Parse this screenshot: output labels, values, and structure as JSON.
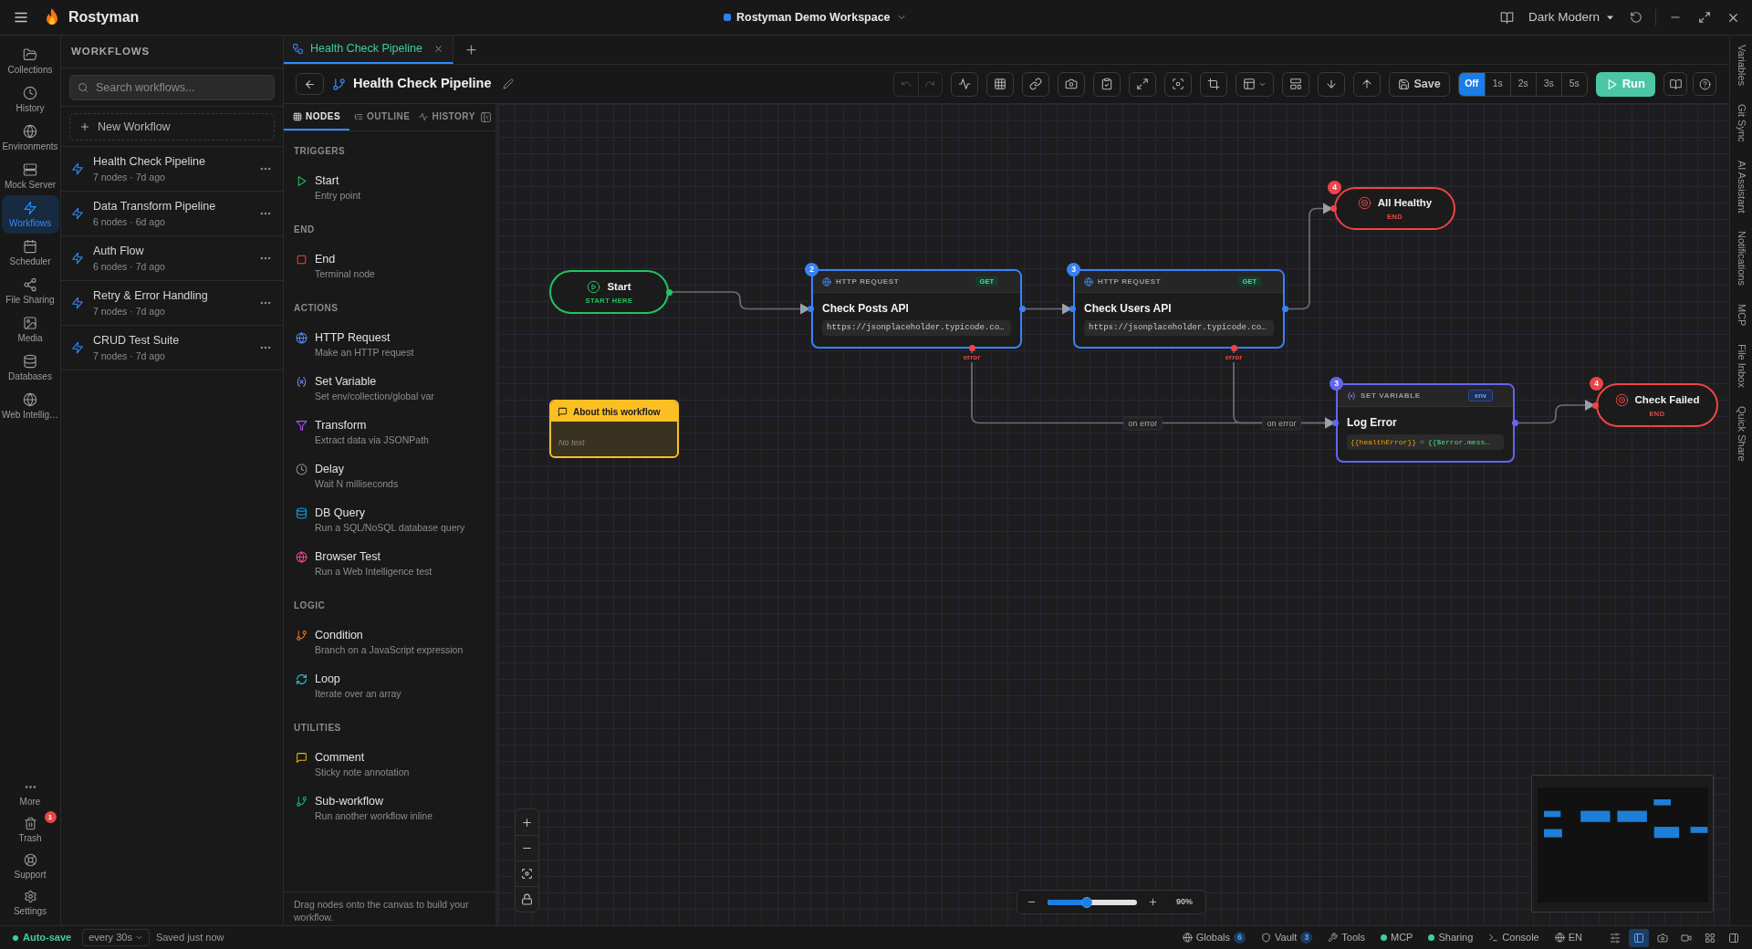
{
  "app_bar": {
    "title": "Rostyman",
    "workspace": "Rostyman Demo Workspace",
    "theme": "Dark Modern"
  },
  "nav_rail": {
    "items": [
      {
        "label": "Collections",
        "selected": false
      },
      {
        "label": "History",
        "selected": false
      },
      {
        "label": "Environments",
        "selected": false
      },
      {
        "label": "Mock Server",
        "selected": false
      },
      {
        "label": "Workflows",
        "selected": true
      },
      {
        "label": "Scheduler",
        "selected": false
      },
      {
        "label": "File Sharing",
        "selected": false
      },
      {
        "label": "Media",
        "selected": false
      },
      {
        "label": "Databases",
        "selected": false
      },
      {
        "label": "Web Intellig…",
        "selected": false
      }
    ],
    "bottom_items": [
      {
        "label": "More"
      },
      {
        "label": "Trash",
        "badge": "1"
      },
      {
        "label": "Support"
      },
      {
        "label": "Settings"
      }
    ]
  },
  "workflows_panel": {
    "title": "WORKFLOWS",
    "search": {
      "placeholder": "Search workflows..."
    },
    "new_button": "New Workflow",
    "items": [
      {
        "name": "Health Check Pipeline",
        "meta": "7 nodes · 7d ago"
      },
      {
        "name": "Data Transform Pipeline",
        "meta": "6 nodes · 6d ago"
      },
      {
        "name": "Auth Flow",
        "meta": "6 nodes · 7d ago"
      },
      {
        "name": "Retry & Error Handling",
        "meta": "7 nodes · 7d ago"
      },
      {
        "name": "CRUD Test Suite",
        "meta": "7 nodes · 7d ago"
      }
    ]
  },
  "tabs": [
    {
      "label": "Health Check Pipeline",
      "selected": true
    }
  ],
  "editor": {
    "title": "Health Check Pipeline",
    "toolbar": {
      "history_buttons": [
        {
          "disabled": true
        },
        {
          "disabled": true
        }
      ],
      "save": "Save",
      "intervals": [
        {
          "label": "Off",
          "selected": true
        },
        {
          "label": "1s",
          "selected": false
        },
        {
          "label": "2s",
          "selected": false
        },
        {
          "label": "3s",
          "selected": false
        },
        {
          "label": "5s",
          "selected": false
        }
      ],
      "run": "Run"
    }
  },
  "palette": {
    "tabs": [
      {
        "label": "NODES",
        "selected": true
      },
      {
        "label": "OUTLINE",
        "selected": false
      },
      {
        "label": "HISTORY",
        "selected": false
      }
    ],
    "sections": [
      {
        "title": "TRIGGERS",
        "items": [
          {
            "kind": "start",
            "name": "Start",
            "description": "Entry point"
          }
        ]
      },
      {
        "title": "END",
        "items": [
          {
            "kind": "end",
            "name": "End",
            "description": "Terminal node"
          }
        ]
      },
      {
        "title": "ACTIONS",
        "items": [
          {
            "kind": "http",
            "name": "HTTP Request",
            "description": "Make an HTTP request"
          },
          {
            "kind": "set_variable",
            "name": "Set Variable",
            "description": "Set env/collection/global var"
          },
          {
            "kind": "transform",
            "name": "Transform",
            "description": "Extract data via JSONPath"
          },
          {
            "kind": "delay",
            "name": "Delay",
            "description": "Wait N milliseconds"
          },
          {
            "kind": "db_query",
            "name": "DB Query",
            "description": "Run a SQL/NoSQL database query"
          },
          {
            "kind": "browser_test",
            "name": "Browser Test",
            "description": "Run a Web Intelligence test"
          }
        ]
      },
      {
        "title": "LOGIC",
        "items": [
          {
            "kind": "condition",
            "name": "Condition",
            "description": "Branch on a JavaScript expression"
          },
          {
            "kind": "loop",
            "name": "Loop",
            "description": "Iterate over an array"
          }
        ]
      },
      {
        "title": "UTILITIES",
        "items": [
          {
            "kind": "comment",
            "name": "Comment",
            "description": "Sticky note annotation"
          },
          {
            "kind": "sub_workflow",
            "name": "Sub-workflow",
            "description": "Run another workflow inline"
          }
        ]
      }
    ],
    "footer": "Drag nodes onto the canvas to build your workflow."
  },
  "canvas": {
    "nodes": [
      {
        "kind": "start",
        "title": "Start",
        "subtitle": "START HERE"
      },
      {
        "kind": "http",
        "step": "2",
        "type_label": "HTTP REQUEST",
        "method": "GET",
        "title": "Check Posts API",
        "url": "https://jsonplaceholder.typicode.co…",
        "error_label": "error",
        "error_edge_label": "on error"
      },
      {
        "kind": "http",
        "step": "3",
        "type_label": "HTTP REQUEST",
        "method": "GET",
        "title": "Check Users API",
        "url": "https://jsonplaceholder.typicode.co…",
        "error_label": "error",
        "error_edge_label": "on error"
      },
      {
        "kind": "end",
        "step": "4",
        "title": "All Healthy",
        "subtitle": "END"
      },
      {
        "kind": "set_variable",
        "step": "3",
        "type_label": "SET VARIABLE",
        "scope": "env",
        "title": "Log Error",
        "variable": "{{healthError}}",
        "operator": "=",
        "value": "{{$error.mess…"
      },
      {
        "kind": "end",
        "step": "4",
        "title": "Check Failed",
        "subtitle": "END"
      },
      {
        "kind": "comment",
        "title": "About this workflow",
        "body": "No text"
      }
    ],
    "zoom": {
      "level": 0.44,
      "reading": "90%"
    }
  },
  "right_rail": [
    "Variables",
    "Git Sync",
    "AI Assistant",
    "Notifications",
    "MCP",
    "File Inbox",
    "Quick Share"
  ],
  "status_bar": {
    "autosave": {
      "label": "Auto-save",
      "on": true
    },
    "interval": "every 30s",
    "saved": "Saved just now",
    "items": [
      {
        "kind": "globals",
        "label": "Globals",
        "count": "6"
      },
      {
        "kind": "vault",
        "label": "Vault",
        "count": "3"
      },
      {
        "kind": "tools",
        "label": "Tools"
      },
      {
        "kind": "status",
        "label": "MCP",
        "on": true
      },
      {
        "kind": "status",
        "label": "Sharing",
        "on": true
      },
      {
        "kind": "console",
        "label": "Console"
      },
      {
        "kind": "language",
        "label": "EN"
      }
    ],
    "layout_buttons": [
      {
        "selected": false
      },
      {
        "selected": true
      },
      {
        "selected": false
      },
      {
        "selected": false
      },
      {
        "selected": false
      },
      {
        "selected": false
      }
    ]
  }
}
